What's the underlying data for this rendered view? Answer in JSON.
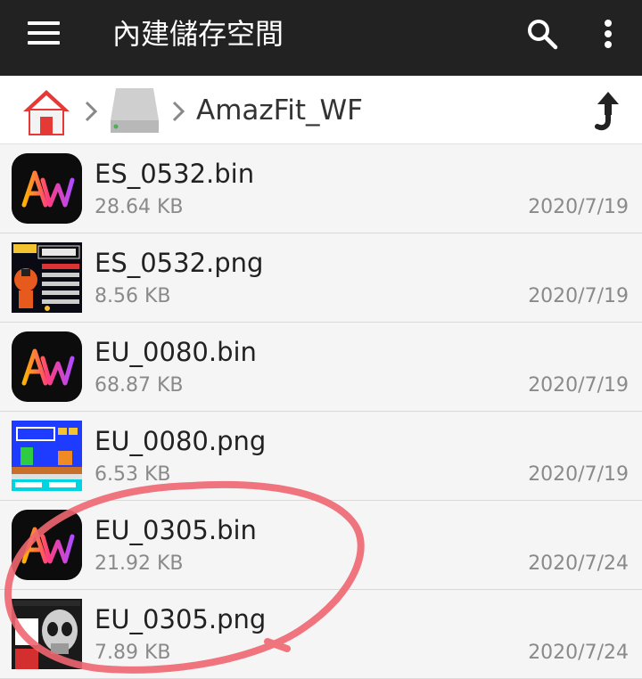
{
  "header": {
    "title": "內建儲存空間",
    "menu_icon": "hamburger-menu-icon",
    "search_icon": "search-icon",
    "more_icon": "more-vertical-icon"
  },
  "breadcrumb": {
    "home_icon": "home-icon",
    "drive_icon": "internal-storage-icon",
    "current_folder": "AmazFit_WF",
    "up_icon": "navigate-up-icon"
  },
  "files": [
    {
      "name": "ES_0532.bin",
      "size": "28.64 KB",
      "date": "2020/7/19",
      "thumb": "amazfit-logo"
    },
    {
      "name": "ES_0532.png",
      "size": "8.56 KB",
      "date": "2020/7/19",
      "thumb": "dragonball-watchface"
    },
    {
      "name": "EU_0080.bin",
      "size": "68.87 KB",
      "date": "2020/7/19",
      "thumb": "amazfit-logo"
    },
    {
      "name": "EU_0080.png",
      "size": "6.53 KB",
      "date": "2020/7/19",
      "thumb": "mario-watchface"
    },
    {
      "name": "EU_0305.bin",
      "size": "21.92 KB",
      "date": "2020/7/24",
      "thumb": "amazfit-logo"
    },
    {
      "name": "EU_0305.png",
      "size": "7.89 KB",
      "date": "2020/7/24",
      "thumb": "skull-watchface"
    }
  ],
  "colors": {
    "appbar": "#222222",
    "annotation": "#f06670",
    "home_red": "#e53935"
  }
}
